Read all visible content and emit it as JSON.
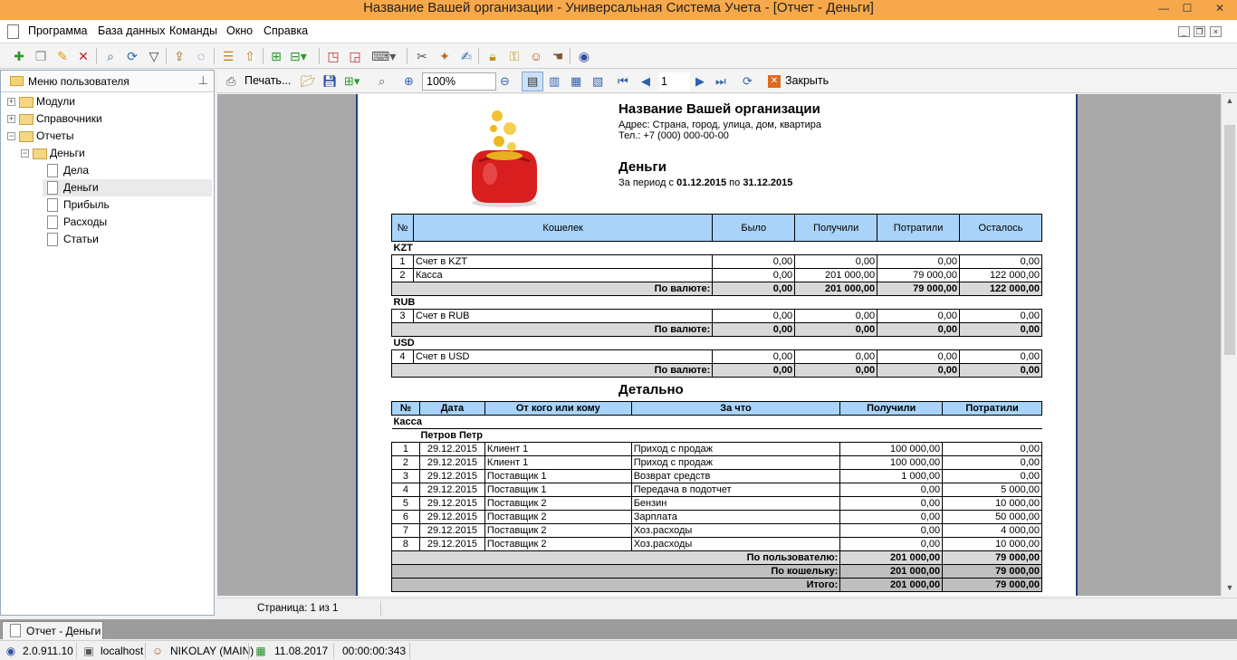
{
  "window": {
    "title": "Название Вашей организации - Универсальная Система Учета - [Отчет - Деньги]",
    "minimize": "—",
    "maximize": "☐",
    "close": "✕"
  },
  "menu": {
    "items": [
      "Программа",
      "База данных",
      "Команды",
      "Окно",
      "Справка"
    ]
  },
  "main_toolbar": {
    "icons": [
      "add-icon",
      "copy-icon",
      "edit-icon",
      "delete-icon",
      "find-icon",
      "refresh-icon",
      "filter-icon",
      "export-icon",
      "comment-icon",
      "tree-icon",
      "tree-up-icon",
      "import-icon",
      "import-menu-icon",
      "new-window-icon",
      "close-window-icon",
      "keyboard-icon",
      "tools-icon",
      "wand-icon",
      "note-icon",
      "lock-icon",
      "key-icon",
      "users-icon",
      "hand-icon",
      "help-icon"
    ]
  },
  "left_panel": {
    "title": "Меню пользователя",
    "tree": [
      {
        "label": "Модули",
        "level": 0,
        "type": "folder",
        "expander": "+"
      },
      {
        "label": "Справочники",
        "level": 0,
        "type": "folder",
        "expander": "+"
      },
      {
        "label": "Отчеты",
        "level": 0,
        "type": "folder",
        "expander": "−"
      },
      {
        "label": "Деньги",
        "level": 1,
        "type": "folder",
        "expander": "−"
      },
      {
        "label": "Дела",
        "level": 2,
        "type": "page"
      },
      {
        "label": "Деньги",
        "level": 2,
        "type": "page",
        "selected": true
      },
      {
        "label": "Прибыль",
        "level": 2,
        "type": "page"
      },
      {
        "label": "Расходы",
        "level": 2,
        "type": "page"
      },
      {
        "label": "Статьи",
        "level": 2,
        "type": "page"
      }
    ]
  },
  "report_toolbar": {
    "print_label": "Печать...",
    "zoom": "100%",
    "page": "1",
    "close_label": "Закрыть"
  },
  "report": {
    "org_name": "Название Вашей организации",
    "address": "Адрес: Страна, город, улица, дом, квартира",
    "phone": "Тел.: +7 (000) 000-00-00",
    "title": "Деньги",
    "period_prefix": "За период с ",
    "period_from": "01.12.2015",
    "period_mid": " по ",
    "period_to": "31.12.2015",
    "summary": {
      "headers": [
        "№",
        "Кошелек",
        "Было",
        "Получили",
        "Потратили",
        "Осталось"
      ],
      "groups": [
        {
          "currency": "KZT",
          "rows": [
            {
              "n": "1",
              "name": "Счет в KZT",
              "was": "0,00",
              "got": "0,00",
              "spent": "0,00",
              "left": "0,00"
            },
            {
              "n": "2",
              "name": "Касса",
              "was": "0,00",
              "got": "201 000,00",
              "spent": "79 000,00",
              "left": "122 000,00"
            }
          ],
          "total_label": "По валюте:",
          "total": {
            "was": "0,00",
            "got": "201 000,00",
            "spent": "79 000,00",
            "left": "122 000,00"
          }
        },
        {
          "currency": "RUB",
          "rows": [
            {
              "n": "3",
              "name": "Счет в RUB",
              "was": "0,00",
              "got": "0,00",
              "spent": "0,00",
              "left": "0,00"
            }
          ],
          "total_label": "По валюте:",
          "total": {
            "was": "0,00",
            "got": "0,00",
            "spent": "0,00",
            "left": "0,00"
          }
        },
        {
          "currency": "USD",
          "rows": [
            {
              "n": "4",
              "name": "Счет в USD",
              "was": "0,00",
              "got": "0,00",
              "spent": "0,00",
              "left": "0,00"
            }
          ],
          "total_label": "По валюте:",
          "total": {
            "was": "0,00",
            "got": "0,00",
            "spent": "0,00",
            "left": "0,00"
          }
        }
      ]
    },
    "detail_title": "Детально",
    "detail": {
      "headers": [
        "№",
        "Дата",
        "От кого или кому",
        "За что",
        "Получили",
        "Потратили"
      ],
      "wallet": "Касса",
      "user": "Петров Петр",
      "rows": [
        {
          "n": "1",
          "date": "29.12.2015",
          "who": "Клиент 1",
          "what": "Приход с продаж",
          "got": "100 000,00",
          "spent": "0,00"
        },
        {
          "n": "2",
          "date": "29.12.2015",
          "who": "Клиент 1",
          "what": "Приход с продаж",
          "got": "100 000,00",
          "spent": "0,00"
        },
        {
          "n": "3",
          "date": "29.12.2015",
          "who": "Поставщик 1",
          "what": "Возврат средств",
          "got": "1 000,00",
          "spent": "0,00"
        },
        {
          "n": "4",
          "date": "29.12.2015",
          "who": "Поставщик 1",
          "what": "Передача в подотчет",
          "got": "0,00",
          "spent": "5 000,00"
        },
        {
          "n": "5",
          "date": "29.12.2015",
          "who": "Поставщик 2",
          "what": "Бензин",
          "got": "0,00",
          "spent": "10 000,00"
        },
        {
          "n": "6",
          "date": "29.12.2015",
          "who": "Поставщик 2",
          "what": "Зарплата",
          "got": "0,00",
          "spent": "50 000,00"
        },
        {
          "n": "7",
          "date": "29.12.2015",
          "who": "Поставщик 2",
          "what": "Хоз.расходы",
          "got": "0,00",
          "spent": "4 000,00"
        },
        {
          "n": "8",
          "date": "29.12.2015",
          "who": "Поставщик 2",
          "what": "Хоз.расходы",
          "got": "0,00",
          "spent": "10 000,00"
        }
      ],
      "totals": [
        {
          "label": "По пользователю:",
          "got": "201 000,00",
          "spent": "79 000,00"
        },
        {
          "label": "По кошельку:",
          "got": "201 000,00",
          "spent": "79 000,00"
        },
        {
          "label": "Итого:",
          "got": "201 000,00",
          "spent": "79 000,00"
        }
      ]
    }
  },
  "page_info": "Страница: 1 из 1",
  "tabs": [
    {
      "label": "Отчет - Деньги",
      "active": true
    }
  ],
  "status": {
    "version": "2.0.911.10",
    "server": "localhost",
    "user": "NIKOLAY (MAIN)",
    "date": "11.08.2017",
    "time": "00:00:00:343"
  },
  "colors": {
    "title_bar": "#f6a84a",
    "table_header": "#a9d3f8",
    "page_border": "#223f79"
  }
}
